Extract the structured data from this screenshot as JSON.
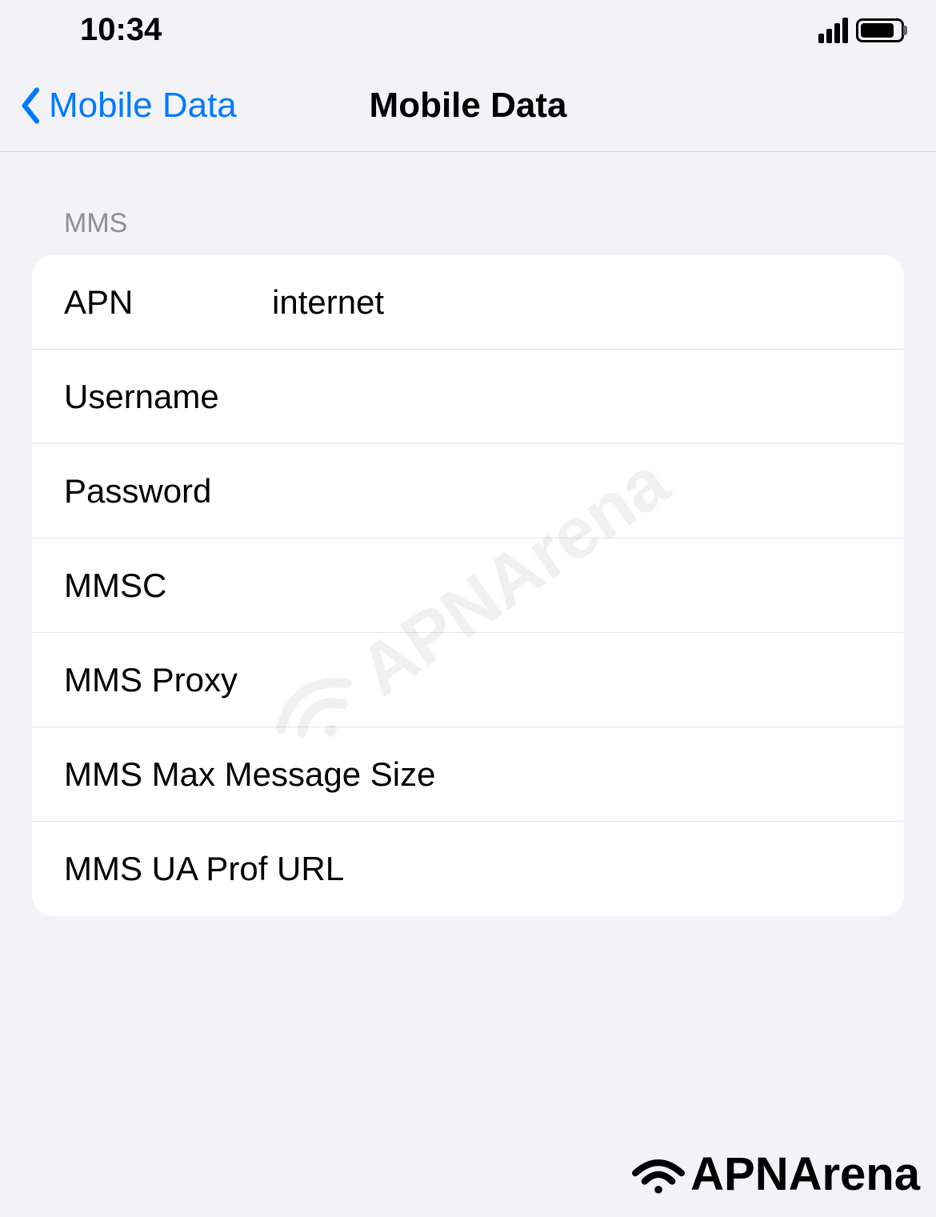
{
  "status_bar": {
    "time": "10:34"
  },
  "nav": {
    "back_label": "Mobile Data",
    "title": "Mobile Data"
  },
  "section": {
    "header": "MMS",
    "rows": {
      "apn": {
        "label": "APN",
        "value": "internet"
      },
      "username": {
        "label": "Username",
        "value": ""
      },
      "password": {
        "label": "Password",
        "value": ""
      },
      "mmsc": {
        "label": "MMSC",
        "value": ""
      },
      "mms_proxy": {
        "label": "MMS Proxy",
        "value": ""
      },
      "mms_max": {
        "label": "MMS Max Message Size",
        "value": ""
      },
      "mms_ua": {
        "label": "MMS UA Prof URL",
        "value": ""
      }
    }
  },
  "watermark": {
    "text": "APNArena"
  }
}
